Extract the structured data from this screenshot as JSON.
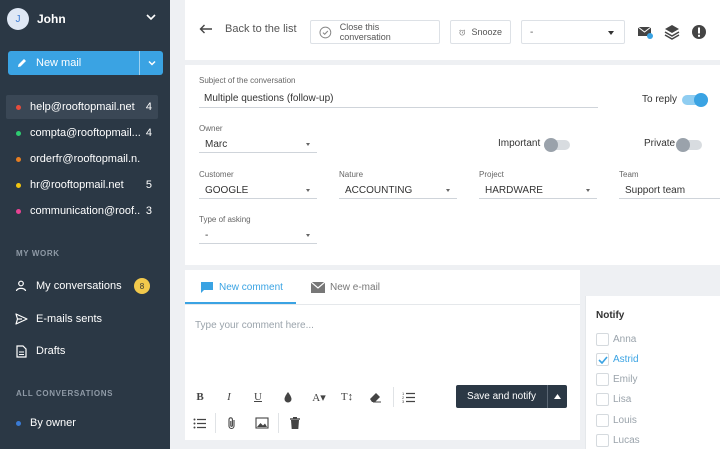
{
  "user": {
    "initial": "J",
    "name": "John"
  },
  "sidebar": {
    "new_mail_label": "New mail",
    "mailboxes": [
      {
        "label": "help@rooftopmail.net",
        "count": "4",
        "color": "#e74c3c",
        "active": true
      },
      {
        "label": "compta@rooftopmail....",
        "count": "4",
        "color": "#2ecc71"
      },
      {
        "label": "orderfr@rooftopmail.n...",
        "count": "",
        "color": "#e67e22"
      },
      {
        "label": "hr@rooftopmail.net",
        "count": "5",
        "color": "#f1c40f"
      },
      {
        "label": "communication@roof...",
        "count": "3",
        "color": "#e84393"
      }
    ],
    "my_work_title": "MY WORK",
    "my_work": [
      {
        "label": "My conversations",
        "icon": "person-icon",
        "badge": "8"
      },
      {
        "label": "E-mails sents",
        "icon": "send-icon"
      },
      {
        "label": "Drafts",
        "icon": "document-icon"
      }
    ],
    "all_title": "ALL CONVERSATIONS",
    "all_items": [
      {
        "label": "By owner",
        "color": "#3a7bd5"
      }
    ]
  },
  "toolbar": {
    "back_label": "Back to the list",
    "close_label": "Close this conversation",
    "snooze_label": "Snooze",
    "status_value": "-"
  },
  "form": {
    "subject_label": "Subject of the conversation",
    "subject_value": "Multiple questions (follow-up)",
    "to_reply_label": "To reply",
    "to_reply_on": true,
    "owner_label": "Owner",
    "owner_value": "Marc",
    "important_label": "Important",
    "important_on": false,
    "private_label": "Private",
    "private_on": false,
    "customer_label": "Customer",
    "customer_value": "GOOGLE",
    "nature_label": "Nature",
    "nature_value": "ACCOUNTING",
    "project_label": "Project",
    "project_value": "HARDWARE",
    "team_label": "Team",
    "team_value": "Support team",
    "asking_label": "Type of asking",
    "asking_value": "-"
  },
  "composer": {
    "tab_comment": "New comment",
    "tab_email": "New e-mail",
    "placeholder": "Type your comment here...",
    "save_label": "Save and notify"
  },
  "notify": {
    "title": "Notify",
    "people": [
      {
        "name": "Anna",
        "checked": false
      },
      {
        "name": "Astrid",
        "checked": true
      },
      {
        "name": "Emily",
        "checked": false
      },
      {
        "name": "Lisa",
        "checked": false
      },
      {
        "name": "Louis",
        "checked": false
      },
      {
        "name": "Lucas",
        "checked": false
      }
    ]
  },
  "colors": {
    "accent": "#3aa3e3",
    "sidebar_bg": "#2b3845",
    "dark_button": "#2b3845"
  }
}
